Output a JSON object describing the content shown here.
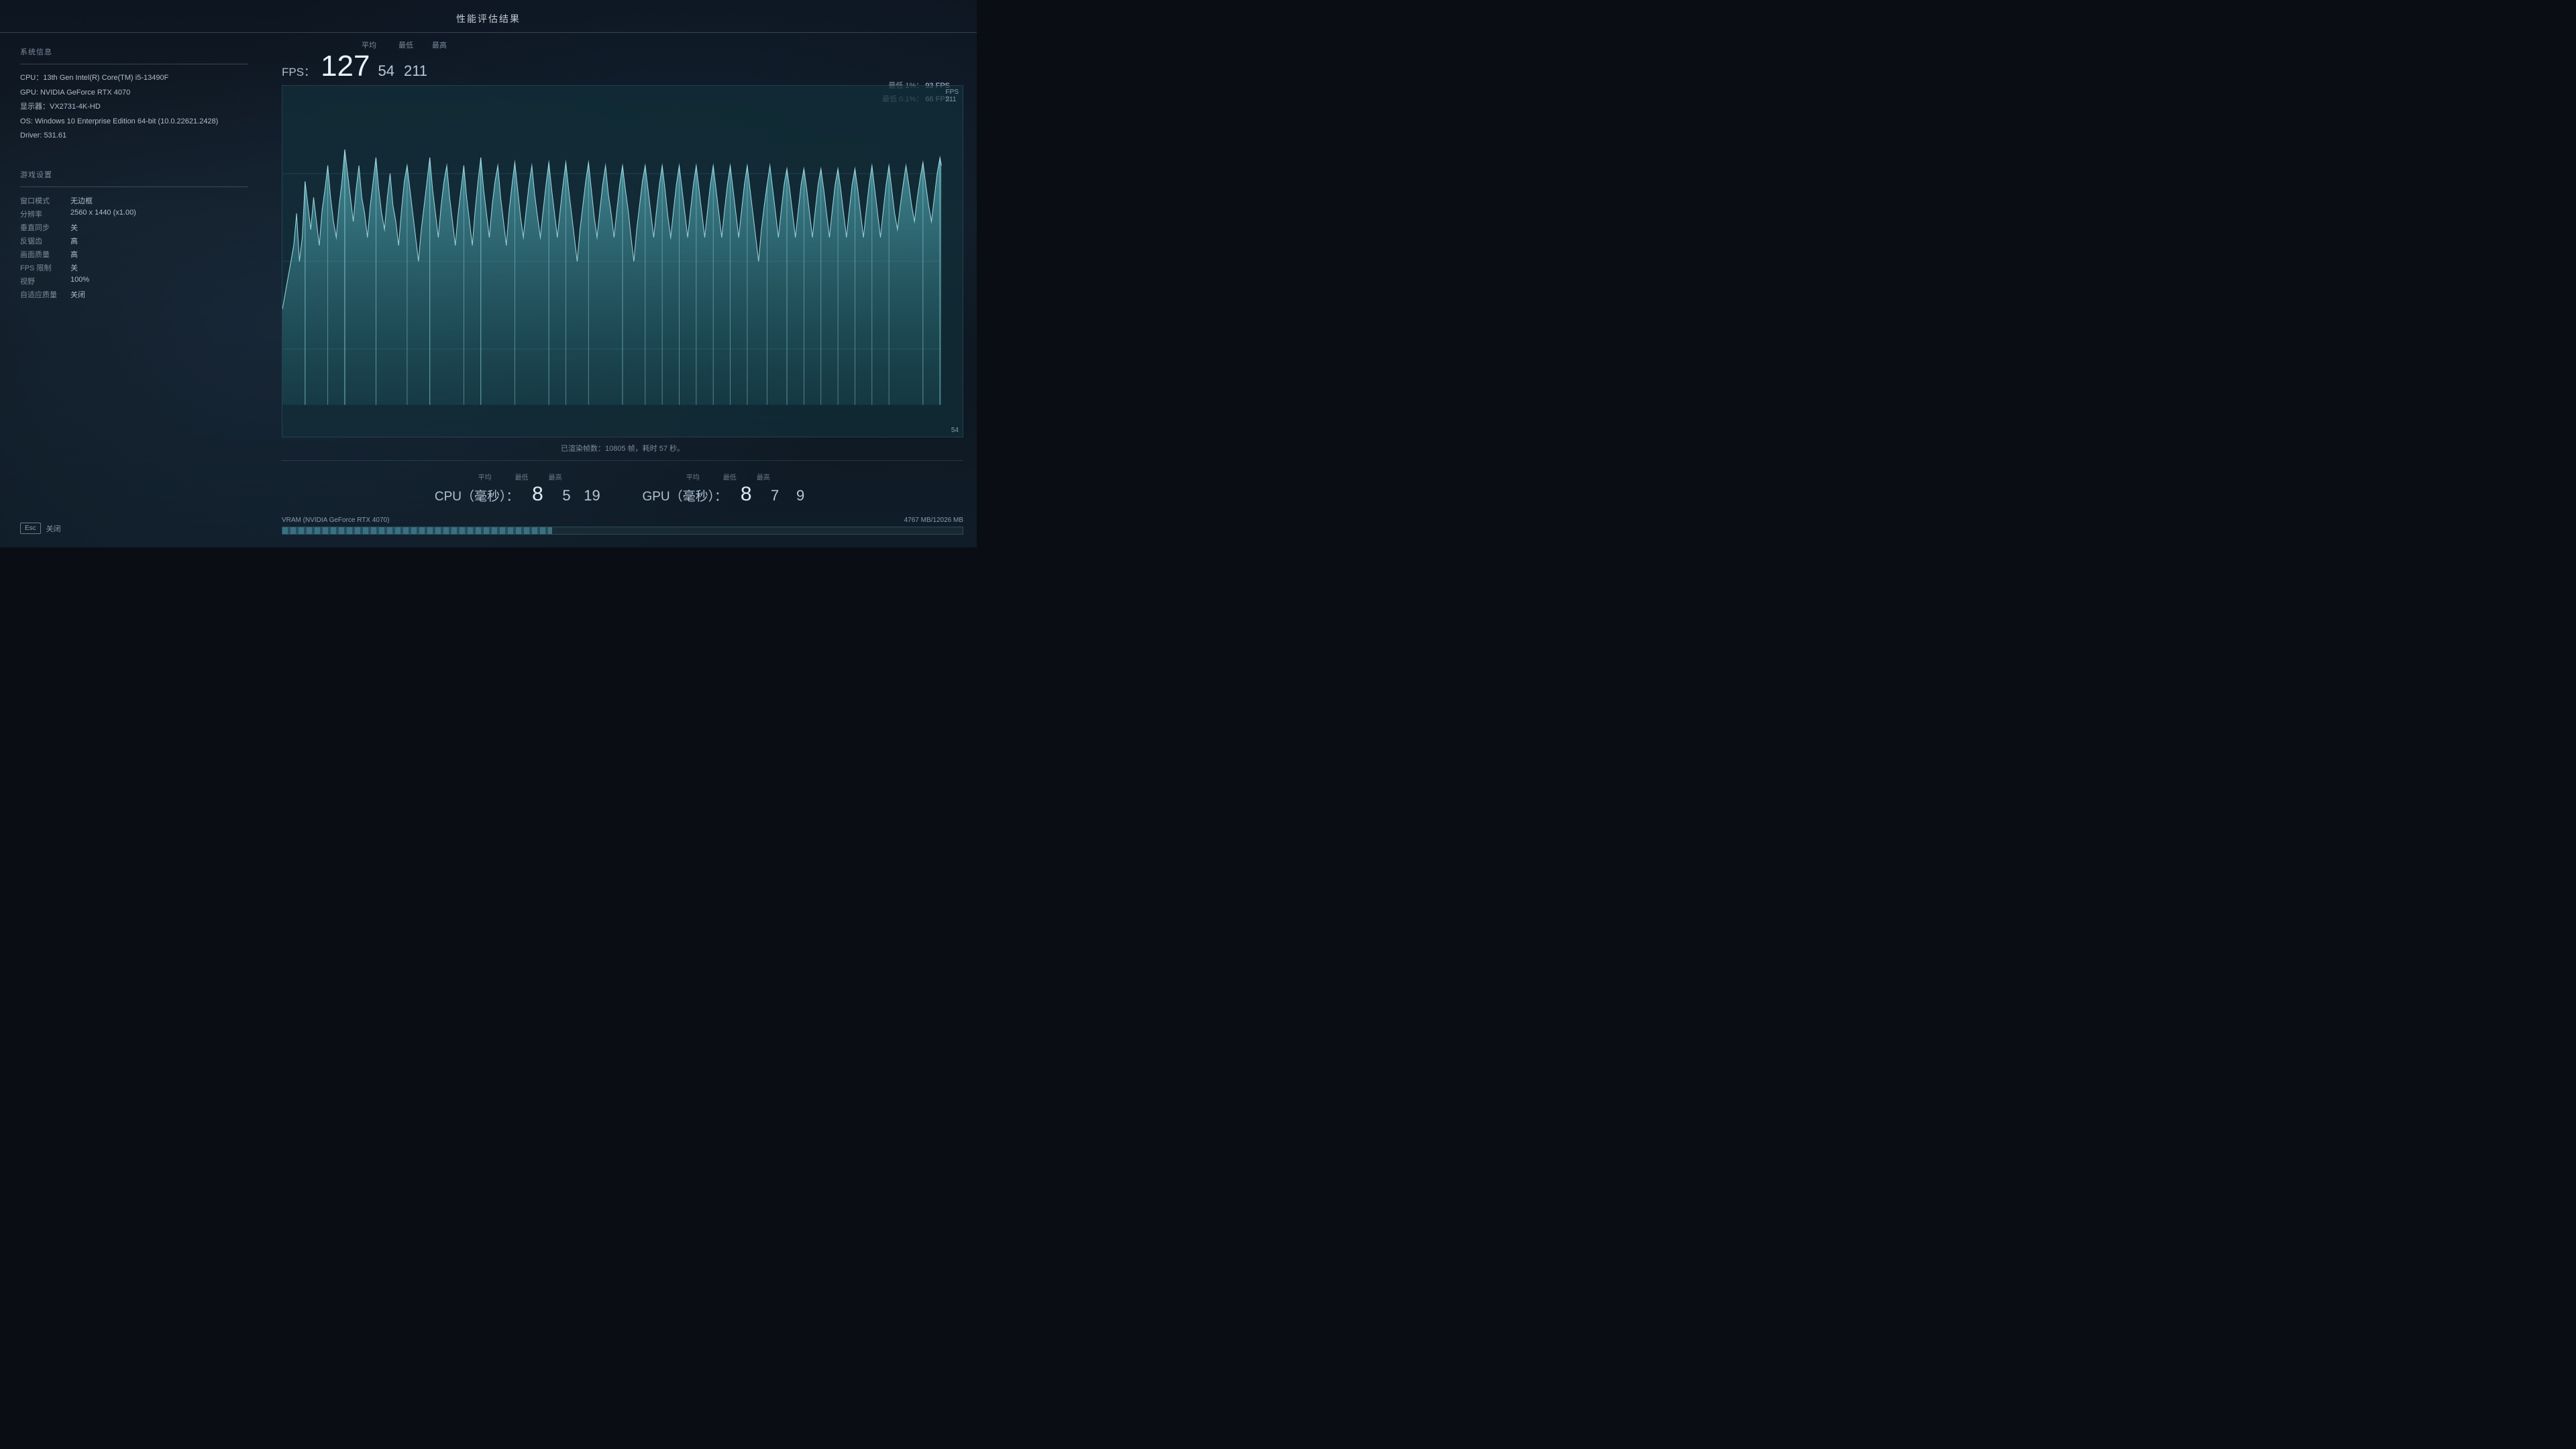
{
  "title": "性能评估结果",
  "system_info": {
    "section_label": "系统信息",
    "cpu": "CPU：13th Gen Intel(R) Core(TM) i5-13490F",
    "gpu": "GPU: NVIDIA GeForce RTX 4070",
    "display": "显示器：VX2731-4K-HD",
    "os": "OS: Windows 10 Enterprise Edition 64-bit (10.0.22621.2428)",
    "driver": "Driver: 531.61"
  },
  "game_settings": {
    "section_label": "游戏设置",
    "items": [
      {
        "key": "窗口模式",
        "value": "无边框"
      },
      {
        "key": "分辨率",
        "value": "2560 x 1440 (x1.00)"
      },
      {
        "key": "垂直同步",
        "value": "关"
      },
      {
        "key": "反锯齿",
        "value": "高"
      },
      {
        "key": "画面质量",
        "value": "高"
      },
      {
        "key": "FPS 限制",
        "value": "关"
      },
      {
        "key": "视野",
        "value": "100%"
      },
      {
        "key": "自适应质量",
        "value": "关闭"
      }
    ]
  },
  "fps_stats": {
    "label": "FPS：",
    "col_avg": "平均",
    "col_min": "最低",
    "col_max": "最高",
    "avg": "127",
    "min": "54",
    "max": "211",
    "low_1pct_label": "最低 1%：",
    "low_1pct_value": "93 FPS",
    "low_01pct_label": "最低 0.1%：",
    "low_01pct_value": "66 FPS",
    "chart_max_label": "FPS",
    "chart_max_value": "211",
    "chart_min_value": "54",
    "rendered_frames": "已渲染帧数：10805 帧，耗时 57 秒。"
  },
  "cpu_stats": {
    "label": "CPU（毫秒）：",
    "col_avg": "平均",
    "col_min": "最低",
    "col_max": "最高",
    "avg": "8",
    "min": "5",
    "max": "19"
  },
  "gpu_stats": {
    "label": "GPU（毫秒）：",
    "col_avg": "平均",
    "col_min": "最低",
    "col_max": "最高",
    "avg": "8",
    "min": "7",
    "max": "9"
  },
  "vram": {
    "label": "VRAM (NVIDIA GeForce RTX 4070)",
    "value": "4767 MB/12026 MB",
    "fill_percent": 39.6
  },
  "close_button": {
    "esc_label": "Esc",
    "close_label": "关闭"
  }
}
